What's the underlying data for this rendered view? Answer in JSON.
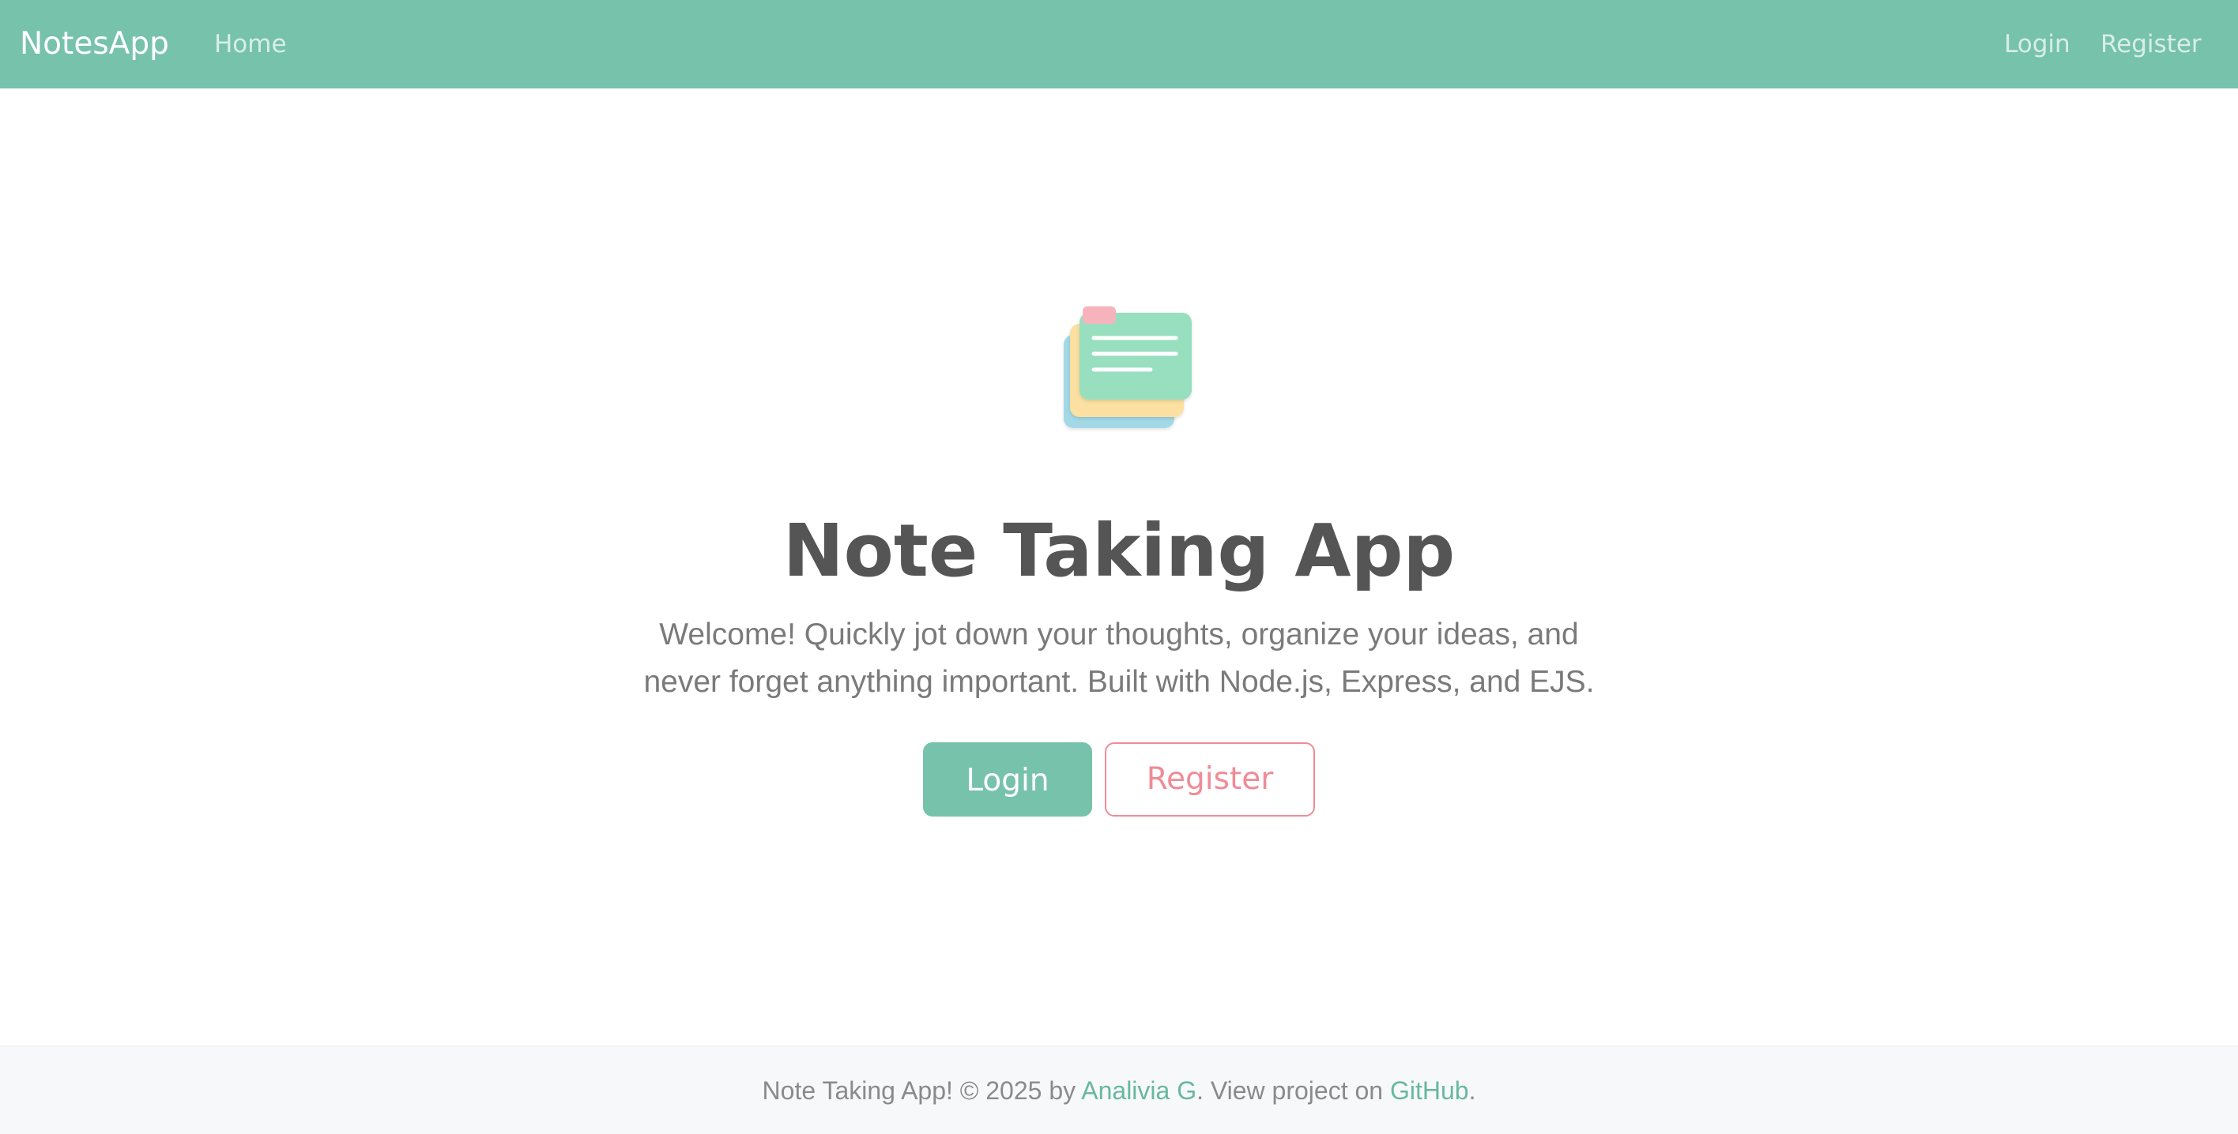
{
  "navbar": {
    "brand": "NotesApp",
    "home_label": "Home",
    "login_label": "Login",
    "register_label": "Register"
  },
  "hero": {
    "icon": "stacked-notes-icon",
    "title": "Note Taking App",
    "description_line1": "Welcome! Quickly jot down your thoughts, organize your ideas, and",
    "description_line2": "never forget anything important. Built with Node.js, Express, and EJS.",
    "login_button": "Login",
    "register_button": "Register"
  },
  "footer": {
    "prefix": "Note Taking App! © 2025 by ",
    "author": "Analivia G",
    "middle": ". View project on ",
    "github": "GitHub",
    "suffix": "."
  },
  "colors": {
    "primary": "#77c2aa",
    "accent": "#ef8c97",
    "heading": "#555555",
    "text": "#7a7a7a"
  }
}
